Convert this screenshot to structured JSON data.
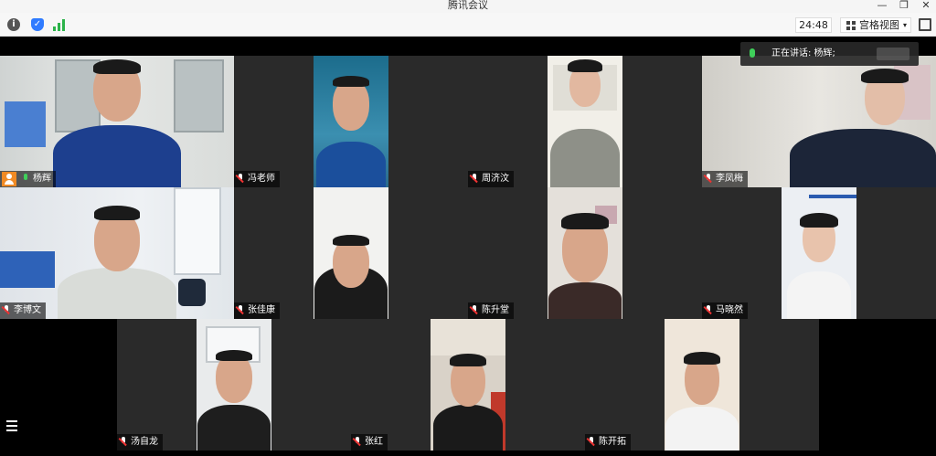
{
  "window": {
    "title": "腾讯会议",
    "minimize": "—",
    "restore": "❐",
    "close": "✕"
  },
  "toolbar": {
    "info_glyph": "i",
    "shield_glyph": "✓",
    "timer": "24:48",
    "view_label": "宫格视图",
    "view_caret": "▾",
    "icons": [
      "info-icon",
      "shield-icon",
      "signal-icon",
      "grid-icon",
      "fullscreen-icon"
    ]
  },
  "speaking": {
    "text": "正在讲话: 杨辉;"
  },
  "participants": [
    {
      "name": "杨辉",
      "mic": "on",
      "host": true
    },
    {
      "name": "冯老师",
      "mic": "off"
    },
    {
      "name": "周济汶",
      "mic": "off"
    },
    {
      "name": "李凤梅",
      "mic": "off"
    },
    {
      "name": "李博文",
      "mic": "off"
    },
    {
      "name": "张佳康",
      "mic": "off"
    },
    {
      "name": "陈升堂",
      "mic": "off"
    },
    {
      "name": "马晓然",
      "mic": "off"
    },
    {
      "name": "汤自龙",
      "mic": "off"
    },
    {
      "name": "张红",
      "mic": "off"
    },
    {
      "name": "陈开拓",
      "mic": "off"
    }
  ],
  "colors": {
    "active_border": "#1aa54b",
    "mic_on": "#3fcf5a",
    "mic_off": "#e33333",
    "host_badge": "#f08a24"
  }
}
